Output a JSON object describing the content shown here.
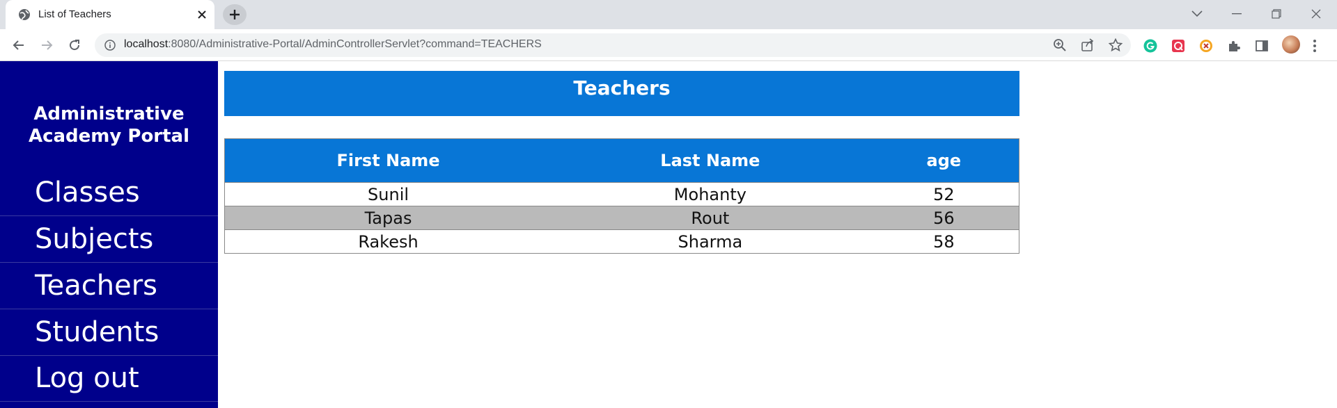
{
  "browser": {
    "tab_title": "List of Teachers",
    "url_host": "localhost",
    "url_path": ":8080/Administrative-Portal/AdminControllerServlet?command=TEACHERS"
  },
  "sidebar": {
    "brand_line1": "Administrative",
    "brand_line2": "Academy Portal",
    "items": [
      {
        "label": "Classes"
      },
      {
        "label": "Subjects"
      },
      {
        "label": "Teachers"
      },
      {
        "label": "Students"
      },
      {
        "label": "Log out"
      }
    ]
  },
  "main": {
    "title": "Teachers",
    "table": {
      "headers": [
        "First Name",
        "Last Name",
        "age"
      ],
      "rows": [
        [
          "Sunil",
          "Mohanty",
          "52"
        ],
        [
          "Tapas",
          "Rout",
          "56"
        ],
        [
          "Rakesh",
          "Sharma",
          "58"
        ]
      ]
    }
  },
  "colors": {
    "sidebar_bg": "#00008b",
    "header_bg": "#0876d6",
    "alt_row_bg": "#bababa"
  }
}
